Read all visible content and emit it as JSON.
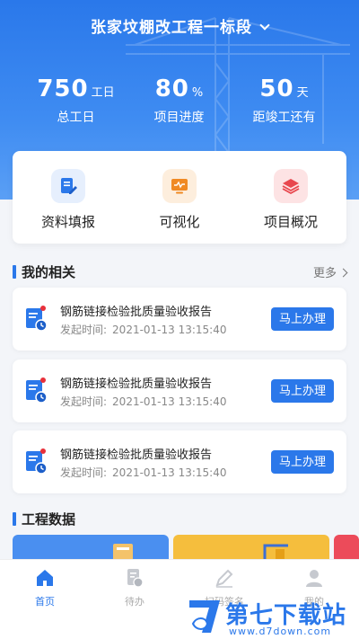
{
  "header": {
    "project_title": "张家坟棚改工程一标段",
    "stats": [
      {
        "value": "750",
        "unit": "工日",
        "label": "总工日"
      },
      {
        "value": "80",
        "unit": "%",
        "label": "项目进度"
      },
      {
        "value": "50",
        "unit": "天",
        "label": "距竣工还有"
      }
    ]
  },
  "quick_actions": [
    {
      "label": "资料填报",
      "icon": "edit-document-icon",
      "color": "#2b78ea"
    },
    {
      "label": "可视化",
      "icon": "monitor-icon",
      "color": "#f08a24"
    },
    {
      "label": "项目概况",
      "icon": "layers-icon",
      "color": "#e8474e"
    }
  ],
  "my_related": {
    "title": "我的相关",
    "more": "更多",
    "tasks": [
      {
        "name": "钢筋链接检验批质量验收报告",
        "time_label": "发起时间:",
        "time_value": "2021-01-13  13:15:40",
        "action": "马上办理"
      },
      {
        "name": "钢筋链接检验批质量验收报告",
        "time_label": "发起时间:",
        "time_value": "2021-01-13  13:15:40",
        "action": "马上办理"
      },
      {
        "name": "钢筋链接检验批质量验收报告",
        "time_label": "发起时间:",
        "time_value": "2021-01-13  13:15:40",
        "action": "马上办理"
      }
    ]
  },
  "engineering_data": {
    "title": "工程数据"
  },
  "bottom_nav": [
    {
      "label": "首页",
      "icon": "home-icon",
      "active": true
    },
    {
      "label": "待办",
      "icon": "todo-icon",
      "active": false
    },
    {
      "label": "扫码签名",
      "icon": "signature-icon",
      "active": false
    },
    {
      "label": "我的",
      "icon": "user-icon",
      "active": false
    }
  ],
  "watermark": {
    "brand": "第七下载站",
    "url": "www.d7down.com"
  },
  "colors": {
    "primary": "#2b78ea",
    "orange": "#f08a24",
    "red": "#e8474e",
    "background": "#f3f5f9"
  }
}
